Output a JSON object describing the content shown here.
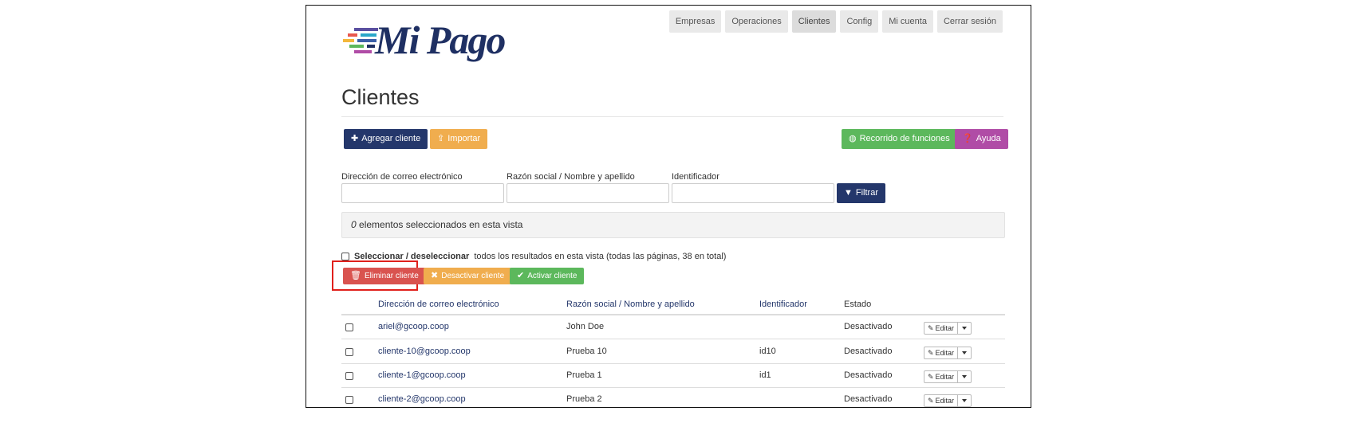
{
  "brand": {
    "name": "Mi Pago"
  },
  "topnav": [
    "Empresas",
    "Operaciones",
    "Clientes",
    "Config",
    "Mi cuenta",
    "Cerrar sesión"
  ],
  "page": {
    "title": "Clientes"
  },
  "actions": {
    "add": "Agregar cliente",
    "import": "Importar",
    "tour": "Recorrido de funciones",
    "help": "Ayuda"
  },
  "filters": {
    "email_label": "Dirección de correo electrónico",
    "name_label": "Razón social / Nombre y apellido",
    "id_label": "Identificador",
    "filter_button": "Filtrar"
  },
  "selection": {
    "count": "0",
    "text": " elementos seleccionados en esta vista",
    "select_all_bold": "Seleccionar / deseleccionar",
    "select_all_rest": "todos los resultados en esta vista (todas las páginas, 38 en total)"
  },
  "bulk": {
    "delete": "Eliminar cliente",
    "deactivate": "Desactivar cliente",
    "activate": "Activar cliente"
  },
  "table": {
    "headers": [
      "Dirección de correo electrónico",
      "Razón social / Nombre y apellido",
      "Identificador",
      "Estado"
    ],
    "edit_label": "Editar",
    "rows": [
      {
        "email": "ariel@gcoop.coop",
        "name": "John Doe",
        "id": "",
        "state": "Desactivado"
      },
      {
        "email": "cliente-10@gcoop.coop",
        "name": "Prueba 10",
        "id": "id10",
        "state": "Desactivado"
      },
      {
        "email": "cliente-1@gcoop.coop",
        "name": "Prueba 1",
        "id": "id1",
        "state": "Desactivado"
      },
      {
        "email": "cliente-2@gcoop.coop",
        "name": "Prueba 2",
        "id": "",
        "state": "Desactivado"
      }
    ]
  },
  "colors": {
    "navy": "#24376b",
    "orange": "#f0ad4e",
    "green": "#5cb85c",
    "purple": "#b04ca6",
    "red": "#d9534f",
    "highlight": "#e0201c"
  }
}
